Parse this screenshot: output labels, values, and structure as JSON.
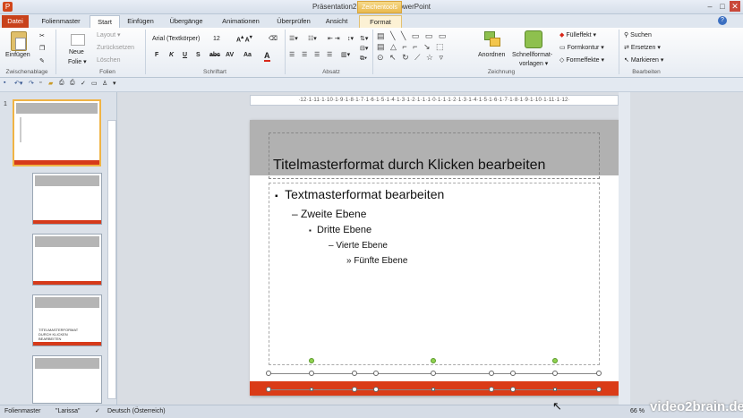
{
  "window": {
    "title": "Präsentation2 - Microsoft PowerPoint",
    "contextual_tab": "Zeichentools"
  },
  "tabs": [
    "Datei",
    "Folienmaster",
    "Start",
    "Einfügen",
    "Übergänge",
    "Animationen",
    "Überprüfen",
    "Ansicht",
    "Format"
  ],
  "ribbon": {
    "clipboard": {
      "paste": "Einfügen",
      "group": "Zwischenablage"
    },
    "slides": {
      "new_slide": "Neue",
      "new_slide2": "Folie ▾",
      "layout": "Layout ▾",
      "reset": "Zurücksetzen",
      "delete": "Löschen",
      "group": "Folien"
    },
    "font": {
      "name": "Arial (Textkörper)",
      "size": "12",
      "group": "Schriftart"
    },
    "paragraph": {
      "group": "Absatz"
    },
    "drawing": {
      "arrange": "Anordnen",
      "quickstyles": "Schnellformat-",
      "quickstyles2": "vorlagen ▾",
      "fill": "Fülleffekt ▾",
      "outline": "Formkontur ▾",
      "effects": "Formeffekte ▾",
      "group": "Zeichnung"
    },
    "editing": {
      "find": "Suchen",
      "replace": "Ersetzen ▾",
      "select": "Markieren ▾",
      "group": "Bearbeiten"
    }
  },
  "slide": {
    "title": "Titelmasterformat durch Klicken bearbeiten",
    "levels": [
      "Textmasterformat bearbeiten",
      "Zweite Ebene",
      "Dritte Ebene",
      "Vierte Ebene",
      "Fünfte Ebene"
    ],
    "bullets": [
      "▪",
      "–",
      "▪",
      "–",
      "»"
    ]
  },
  "ruler_text": "·12·1·11·1·10·1·9·1·8·1·7·1·6·1·5·1·4·1·3·1·2·1·1·1·0·1·1·1·2·1·3·1·4·1·5·1·6·1·7·1·8·1·9·1·10·1·11·1·12·",
  "thumbnails": {
    "first_num": "1",
    "thumb4_text": "TITELMASTERFORMAT DURCH KLICKEN BEARBEITEN"
  },
  "statusbar": {
    "view": "Folienmaster",
    "theme": "\"Larissa\"",
    "language": "Deutsch (Österreich)",
    "zoom": "66 %"
  },
  "watermark": "video2brain.de"
}
